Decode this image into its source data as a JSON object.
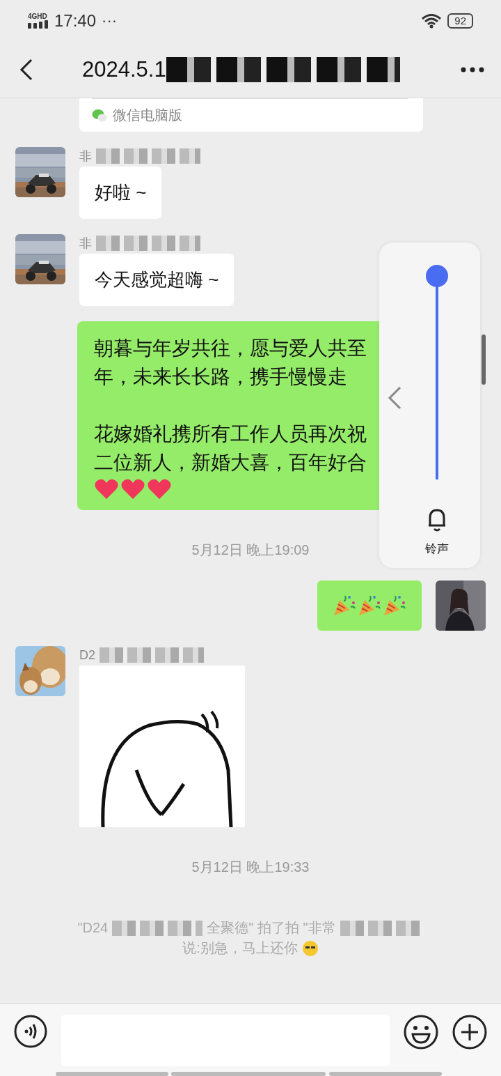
{
  "status_bar": {
    "network": "4GHD",
    "time": "17:40",
    "more": "···",
    "battery": "92"
  },
  "nav": {
    "title": "2024.5.1"
  },
  "link_card": {
    "source": "微信电脑版"
  },
  "messages": [
    {
      "kind": "text",
      "sender": "非",
      "text": "好啦 ~"
    },
    {
      "kind": "text",
      "sender": "非",
      "text": "今天感觉超嗨 ~"
    },
    {
      "kind": "long",
      "paragraphs": [
        [
          "朝暮与年岁共往，愿与爱人共至",
          "年，未来长长路，携手慢慢走"
        ],
        [
          "花嫁婚礼携所有工作人员再次祝",
          "二位新人，新婚大喜，百年好合"
        ]
      ]
    },
    {
      "kind": "time",
      "text": "5月12日 晚上19:09"
    },
    {
      "kind": "emoji"
    },
    {
      "kind": "sticker",
      "sender": "D2"
    },
    {
      "kind": "time",
      "text": "5月12日 晚上19:33"
    },
    {
      "kind": "system",
      "parts": [
        "\"D24",
        "全聚德\" 拍了拍 \"非常"
      ],
      "line2": "说:别急，马上还你"
    }
  ],
  "volume_panel": {
    "level": 1,
    "label": "铃声"
  }
}
